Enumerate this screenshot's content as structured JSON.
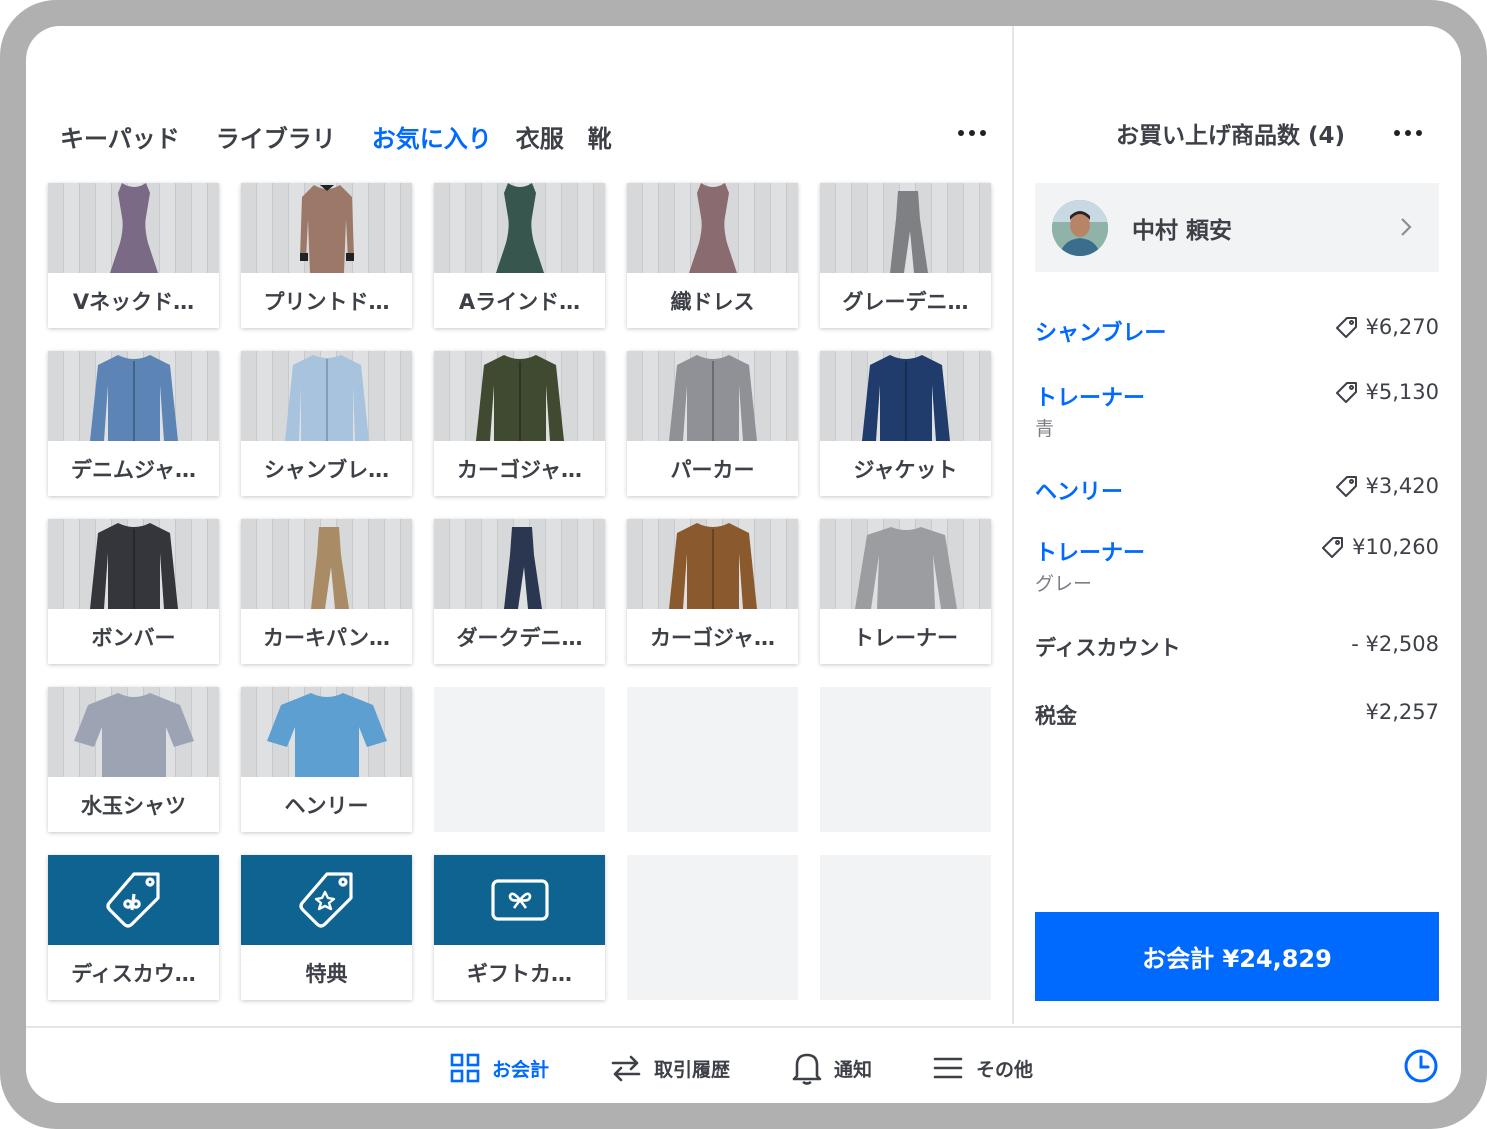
{
  "tabs": [
    "キーパッド",
    "ライブラリ",
    "お気に入り",
    "衣服",
    "靴"
  ],
  "active_tab": "お気に入り",
  "items": [
    {
      "label": "Vネックド…",
      "color": "#7a6a86",
      "type": "dress"
    },
    {
      "label": "プリントド…",
      "color": "#9c7868",
      "type": "dress-long"
    },
    {
      "label": "Aラインド…",
      "color": "#36564e",
      "type": "dress"
    },
    {
      "label": "織ドレス",
      "color": "#8a6c70",
      "type": "dress"
    },
    {
      "label": "グレーデニ…",
      "color": "#7e8084",
      "type": "pants"
    },
    {
      "label": "デニムジャ…",
      "color": "#5c85b6",
      "type": "jacket"
    },
    {
      "label": "シャンブレ…",
      "color": "#a8c3dd",
      "type": "shirt"
    },
    {
      "label": "カーゴジャ…",
      "color": "#3f4a31",
      "type": "jacket"
    },
    {
      "label": "パーカー",
      "color": "#8f9196",
      "type": "jacket"
    },
    {
      "label": "ジャケット",
      "color": "#203c6c",
      "type": "jacket"
    },
    {
      "label": "ボンバー",
      "color": "#34363b",
      "type": "jacket"
    },
    {
      "label": "カーキパン…",
      "color": "#a98c66",
      "type": "pants"
    },
    {
      "label": "ダークデニ…",
      "color": "#2b3750",
      "type": "pants"
    },
    {
      "label": "カーゴジャ…",
      "color": "#8a5a2e",
      "type": "jacket"
    },
    {
      "label": "トレーナー",
      "color": "#9c9da0",
      "type": "sweater"
    },
    {
      "label": "水玉シャツ",
      "color": "#9ca3b3",
      "type": "tshirt"
    },
    {
      "label": "ヘンリー",
      "color": "#5d9fd0",
      "type": "tshirt"
    }
  ],
  "action_tiles": [
    {
      "label": "ディスカウ…",
      "icon": "discount-tag-icon"
    },
    {
      "label": "特典",
      "icon": "star-tag-icon"
    },
    {
      "label": "ギフトカ…",
      "icon": "gift-card-icon"
    }
  ],
  "cart": {
    "title": "お買い上げ商品数 (4)",
    "customer": "中村 頼安",
    "lines": [
      {
        "name": "シャンブレー",
        "price": "¥6,270",
        "variant": ""
      },
      {
        "name": "トレーナー",
        "price": "¥5,130",
        "variant": "青"
      },
      {
        "name": "ヘンリー",
        "price": "¥3,420",
        "variant": ""
      },
      {
        "name": "トレーナー",
        "price": "¥10,260",
        "variant": "グレー"
      }
    ],
    "discount_label": "ディスカウント",
    "discount_value": "- ¥2,508",
    "tax_label": "税金",
    "tax_value": "¥2,257",
    "checkout_label": "お会計 ¥24,829"
  },
  "nav": {
    "checkout": "お会計",
    "transactions": "取引履歴",
    "notifications": "通知",
    "more": "その他"
  },
  "colors": {
    "accent": "#006aff",
    "action_tile": "#0f6391"
  }
}
